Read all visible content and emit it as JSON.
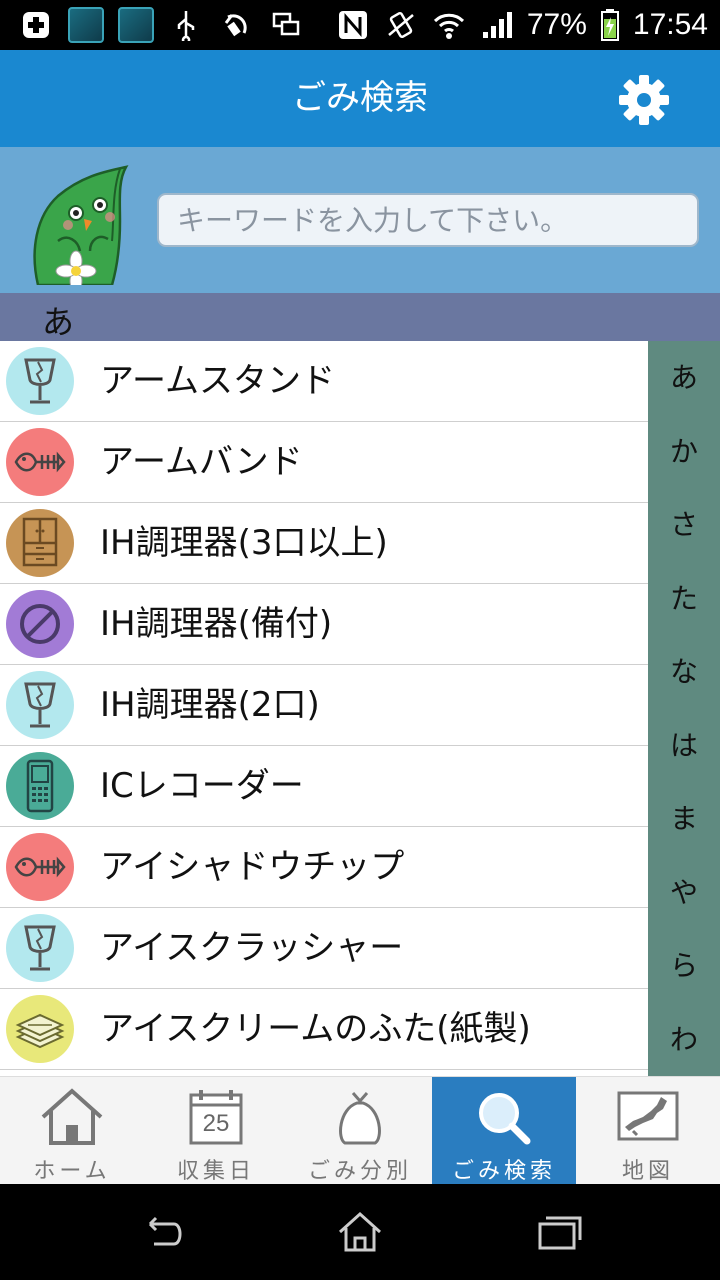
{
  "status_bar": {
    "battery_percent": "77%",
    "time": "17:54"
  },
  "header": {
    "title": "ごみ検索"
  },
  "search": {
    "placeholder": "キーワードを入力して下さい。"
  },
  "section": {
    "label": "あ"
  },
  "items": [
    {
      "label": "アームスタンド",
      "category_color": "#b3e8ee",
      "icon": "broken-glass-icon"
    },
    {
      "label": "アームバンド",
      "category_color": "#f47c7c",
      "icon": "fish-bone-icon"
    },
    {
      "label": "IH調理器(3口以上)",
      "category_color": "#c69455",
      "icon": "cabinet-icon"
    },
    {
      "label": "IH調理器(備付)",
      "category_color": "#a27bd6",
      "icon": "prohibited-icon"
    },
    {
      "label": "IH調理器(2口)",
      "category_color": "#b3e8ee",
      "icon": "broken-glass-icon"
    },
    {
      "label": "ICレコーダー",
      "category_color": "#4aab97",
      "icon": "phone-icon"
    },
    {
      "label": "アイシャドウチップ",
      "category_color": "#f47c7c",
      "icon": "fish-bone-icon"
    },
    {
      "label": "アイスクラッシャー",
      "category_color": "#b3e8ee",
      "icon": "broken-glass-icon"
    },
    {
      "label": "アイスクリームのふた(紙製)",
      "category_color": "#e8e87a",
      "icon": "paper-stack-icon"
    }
  ],
  "index": [
    "あ",
    "か",
    "さ",
    "た",
    "な",
    "は",
    "ま",
    "や",
    "ら",
    "わ"
  ],
  "nav": [
    {
      "label": "ホーム",
      "icon": "home-icon",
      "active": false
    },
    {
      "label": "収集日",
      "icon": "calendar-icon",
      "calendar_day": "25",
      "active": false
    },
    {
      "label": "ごみ分別",
      "icon": "garbage-bag-icon",
      "active": false
    },
    {
      "label": "ごみ検索",
      "icon": "search-icon",
      "active": true
    },
    {
      "label": "地図",
      "icon": "map-icon",
      "active": false
    }
  ],
  "colors": {
    "title_bar": "#1a88d0",
    "search_area": "#6aa8d4",
    "section_header": "#6a77a0",
    "index_bar": "#5f8a80",
    "nav_active": "#2a7dc0"
  }
}
